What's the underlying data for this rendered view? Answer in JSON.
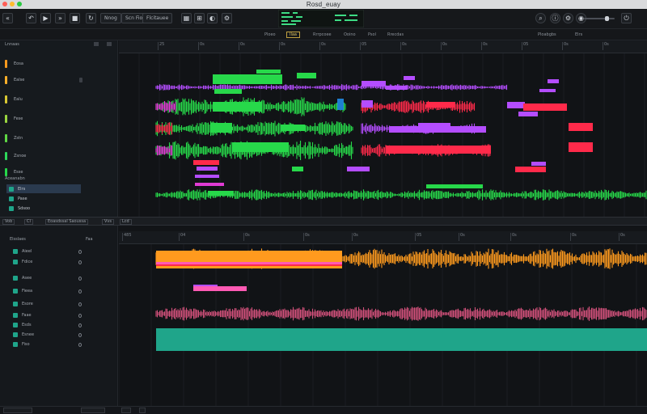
{
  "window": {
    "title": "Rosd_euay"
  },
  "colors": {
    "green": "#27d84a",
    "purple": "#b44dff",
    "magenta": "#e03bd4",
    "red": "#ff2a4a",
    "orange": "#ff9a1e",
    "pink": "#ff5ab4",
    "teal": "#1fa58a",
    "rosewave": "#d0507a"
  },
  "toolbar": {
    "icons": [
      "rewind-icon",
      "back-icon",
      "play-icon",
      "forward-icon",
      "stop-icon",
      "record-icon"
    ],
    "labels": [
      "Nnog",
      "Scn Fiobol",
      "Flcitauee"
    ],
    "right_icons": [
      "search-icon",
      "info-icon",
      "settings-icon",
      "user-icon",
      "power-icon"
    ]
  },
  "subtoolbar": {
    "items": [
      "Ploeo",
      "Ilaa",
      "Rrrpcoee",
      "Ooino",
      "Psol",
      "Rrecdas"
    ],
    "right": [
      "Ploabgbs",
      "Elrs"
    ]
  },
  "tracks_header": {
    "title": "Lnnaas"
  },
  "tracks": [
    {
      "name": "Eosa",
      "color": "#ff9a1e"
    },
    {
      "name": "Ealse",
      "color": "#ffb02a"
    },
    {
      "name": "Ealu",
      "color": "#d8c833"
    },
    {
      "name": "Fese",
      "color": "#9ad640"
    },
    {
      "name": "Zstn",
      "color": "#5fd845"
    },
    {
      "name": "Zsnoe",
      "color": "#2dd85a"
    },
    {
      "name": "Esse",
      "color": "#27d84a"
    }
  ],
  "group": {
    "label": "Aceanabn",
    "items": [
      "Elrs",
      "Pase",
      "Sdsoo"
    ]
  },
  "ruler_top": {
    "marks": [
      "25",
      "0s",
      "0s",
      "0s",
      "0s",
      "05",
      "0s",
      "0s",
      "0s",
      "05",
      "0s",
      "0s"
    ]
  },
  "divider": {
    "items": [
      "Vob",
      "Cl",
      "Eoasdssal Saoussa",
      "Vvs",
      "Lcd"
    ]
  },
  "editor_header": {
    "label": "Elsslaes",
    "right": "Faa"
  },
  "editor_tracks": [
    {
      "name": "Aieel",
      "color": "#1fa58a"
    },
    {
      "name": "Fdice",
      "color": "#1fa58a"
    },
    {
      "name": "Asee",
      "color": "#1fa58a"
    },
    {
      "name": "Fieea",
      "color": "#1fa58a"
    },
    {
      "name": "Esore",
      "color": "#1fa58a"
    },
    {
      "name": "Faae",
      "color": "#1fa58a"
    },
    {
      "name": "Esds",
      "color": "#1fa58a"
    },
    {
      "name": "Esnee",
      "color": "#1fa58a"
    },
    {
      "name": "Fiso",
      "color": "#1fa58a"
    }
  ],
  "ruler_bottom": {
    "marks": [
      "485",
      "04",
      "0s",
      "0s",
      "0s",
      "05",
      "0s",
      "0s",
      "0s",
      "0s",
      "0s"
    ]
  }
}
